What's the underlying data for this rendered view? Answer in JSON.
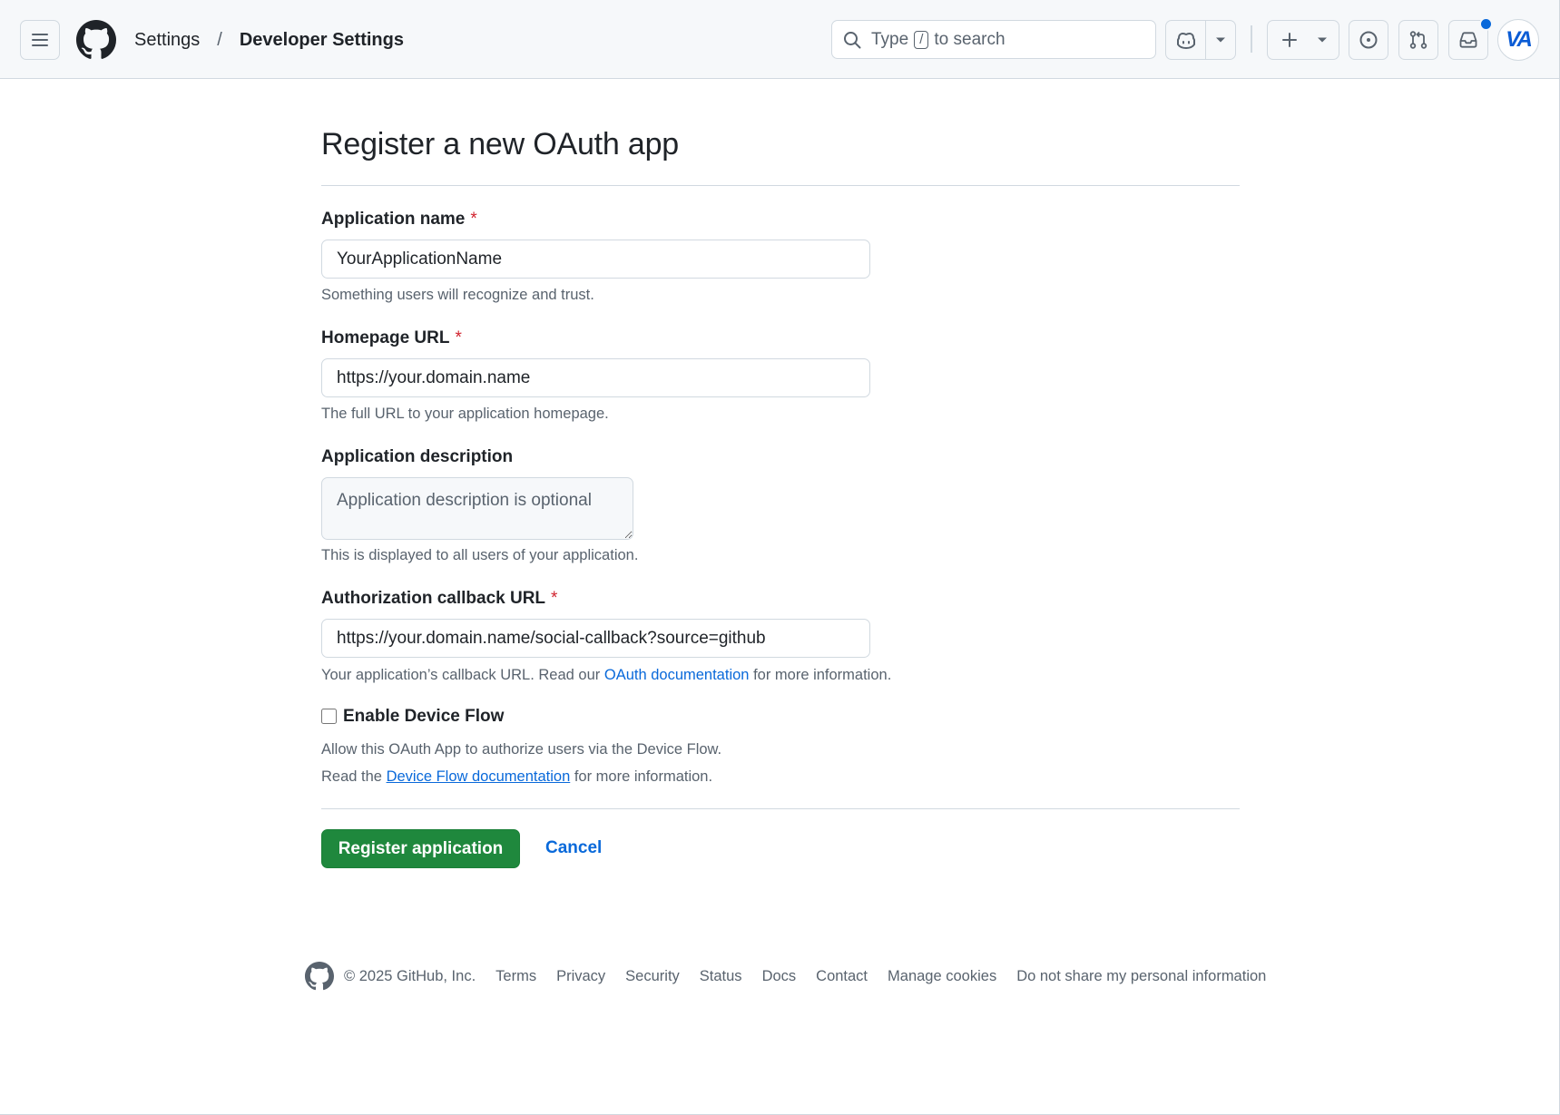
{
  "header": {
    "breadcrumb": {
      "settings": "Settings",
      "separator": "/",
      "current": "Developer Settings"
    },
    "search": {
      "prefix": "Type",
      "key": "/",
      "suffix": "to search"
    },
    "avatar_initials": "VA",
    "icons": [
      "menu-icon",
      "github-logo-icon",
      "search-icon",
      "copilot-icon",
      "chevron-down-icon",
      "plus-icon",
      "issue-icon",
      "pull-request-icon",
      "inbox-icon"
    ],
    "notification_dot_color": "#0969da"
  },
  "form": {
    "title": "Register a new OAuth app",
    "app_name": {
      "label": "Application name",
      "required_mark": "*",
      "value": "YourApplicationName",
      "note": "Something users will recognize and trust."
    },
    "homepage_url": {
      "label": "Homepage URL",
      "required_mark": "*",
      "value": "https://your.domain.name",
      "note": "The full URL to your application homepage."
    },
    "description": {
      "label": "Application description",
      "placeholder": "Application description is optional",
      "note": "This is displayed to all users of your application."
    },
    "callback_url": {
      "label": "Authorization callback URL",
      "required_mark": "*",
      "value": "https://your.domain.name/social-callback?source=github",
      "note_before": "Your application’s callback URL. Read our",
      "note_link": "OAuth documentation",
      "note_after": "for more information."
    },
    "device_flow": {
      "label": "Enable Device Flow",
      "checked": false,
      "note_line1": "Allow this OAuth App to authorize users via the Device Flow.",
      "note_line2_before": "Read the",
      "note_line2_link": "Device Flow documentation",
      "note_line2_after": "for more information."
    },
    "register_button": "Register application",
    "cancel_link": "Cancel",
    "colors": {
      "primary_button": "#1f883d",
      "link": "#0969da",
      "required": "#d1242f"
    }
  },
  "footer": {
    "copyright": "© 2025 GitHub, Inc.",
    "links": [
      "Terms",
      "Privacy",
      "Security",
      "Status",
      "Docs",
      "Contact",
      "Manage cookies",
      "Do not share my personal information"
    ]
  }
}
